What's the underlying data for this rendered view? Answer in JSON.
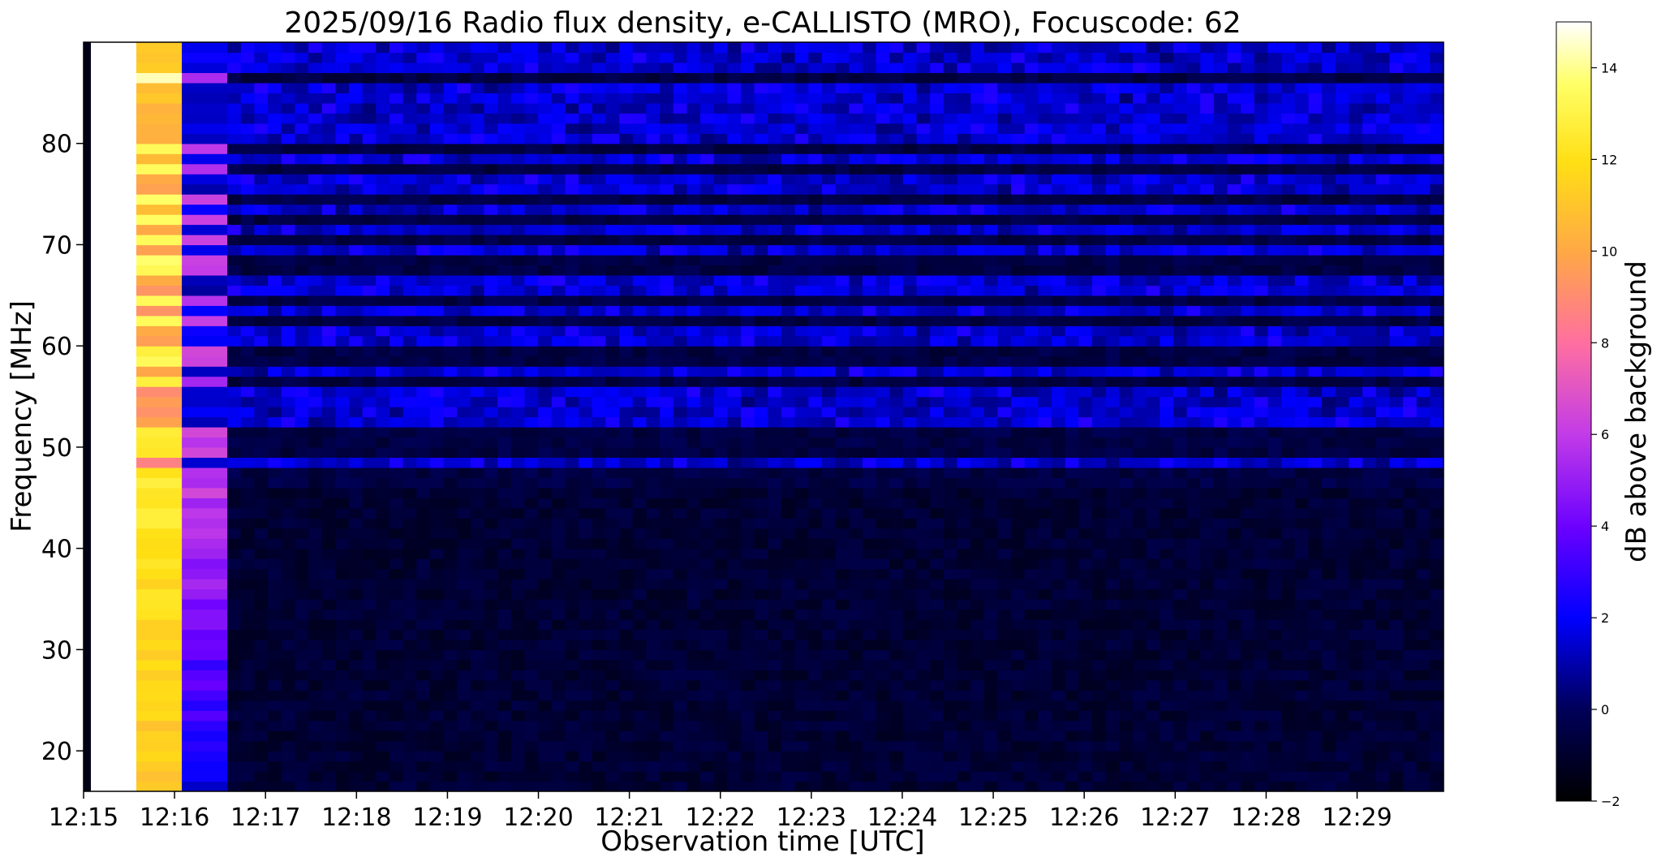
{
  "chart_data": {
    "type": "heatmap",
    "title": "2025/09/16  Radio flux density, e-CALLISTO (MRO), Focuscode: 62",
    "xlabel": "Observation time [UTC]",
    "ylabel": "Frequency [MHz]",
    "colorbar_label": "dB above background",
    "colormap": "gnuplot2",
    "x_ticks": [
      "12:15",
      "12:16",
      "12:17",
      "12:18",
      "12:19",
      "12:20",
      "12:21",
      "12:22",
      "12:23",
      "12:24",
      "12:25",
      "12:26",
      "12:27",
      "12:28",
      "12:29"
    ],
    "xlim_minutes": [
      0,
      14.95
    ],
    "y_ticks": [
      20,
      30,
      40,
      50,
      60,
      70,
      80
    ],
    "ylim": [
      16,
      90
    ],
    "colorbar_ticks": [
      -2,
      0,
      2,
      4,
      6,
      8,
      10,
      12,
      14
    ],
    "clim": [
      -2,
      15
    ],
    "segments": [
      {
        "t_start": 0.0,
        "t_end": 0.08,
        "level_db": -1.5
      },
      {
        "t_start": 0.08,
        "t_end": 0.58,
        "level_db": 15.0
      },
      {
        "t_start": 0.58,
        "t_end": 1.08,
        "level_db": 12.5
      },
      {
        "t_start": 1.08,
        "t_end": 1.58,
        "level_db": 5.0
      },
      {
        "t_start": 1.58,
        "t_end": 14.95,
        "level_db": -0.6
      }
    ],
    "interference_bands_mhz": [
      48.5,
      53,
      55,
      57.5,
      61,
      63.5,
      66,
      69.5,
      71.5,
      73.5,
      76,
      78.5,
      81,
      83,
      85,
      87.5,
      89
    ]
  }
}
